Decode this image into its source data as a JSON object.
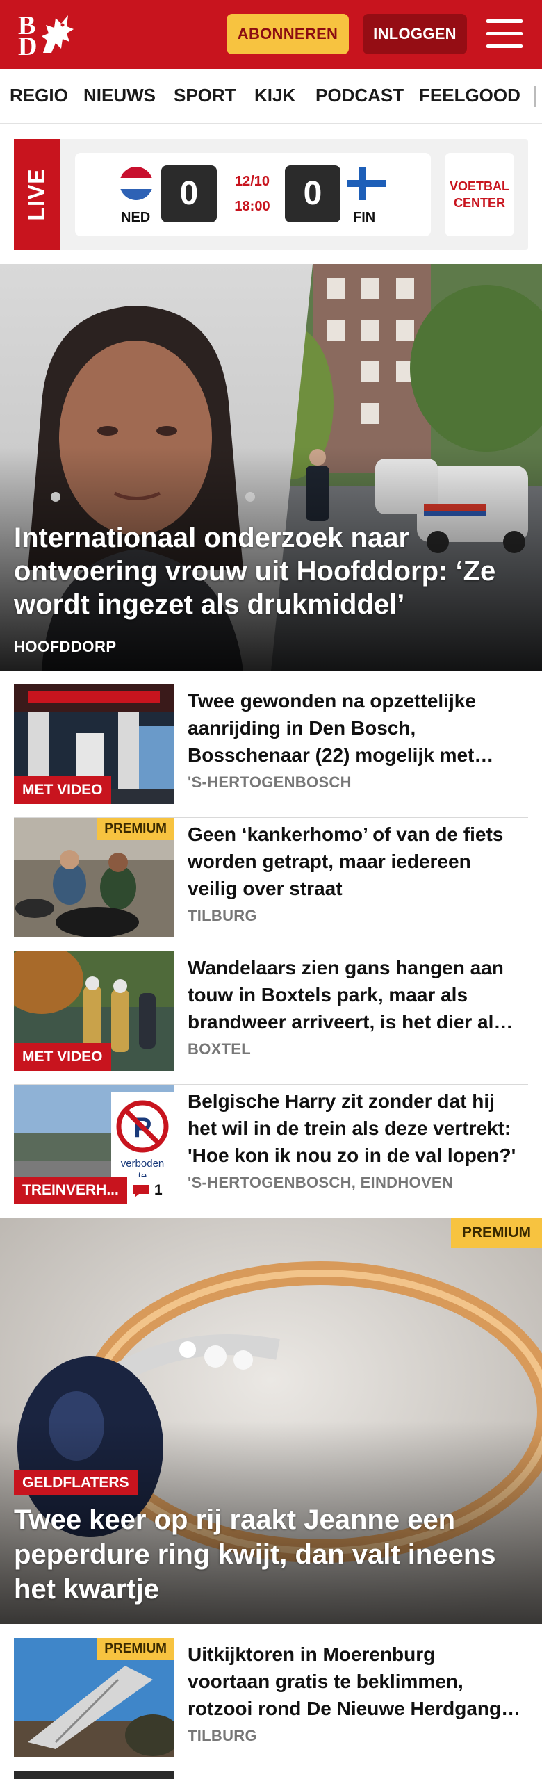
{
  "header": {
    "logo_letters": [
      "B",
      "D"
    ],
    "subscribe_label": "ABONNEREN",
    "login_label": "INLOGGEN"
  },
  "nav": {
    "items": [
      "REGIO",
      "NIEUWS",
      "SPORT",
      "KIJK",
      "PODCAST",
      "FEELGOOD"
    ]
  },
  "live": {
    "tag": "LIVE",
    "home_team": "NED",
    "home_score": "0",
    "date": "12/10",
    "time": "18:00",
    "away_score": "0",
    "away_team": "FIN",
    "voetbal_center": [
      "VOETBAL",
      "CENTER"
    ],
    "colors": {
      "ned": [
        "#c8102e",
        "#ffffff",
        "#2e62b5"
      ],
      "fin_cross": "#1e5fb8"
    }
  },
  "hero": {
    "title": "Internationaal onderzoek naar ontvoering vrouw uit Hoofddorp: ‘Ze wordt ingezet als drukmiddel’",
    "location": "HOOFDDORP"
  },
  "articles": [
    {
      "title": "Twee gewonden na opzettelijke aanrijding in Den Bosch, Bosschenaar (22) mogelijk met psychische problemen",
      "location": "'S-HERTOGENBOSCH",
      "badge": "MET VIDEO",
      "premium": "",
      "comments": ""
    },
    {
      "title": "Geen ‘kankerhomo’ of van de fiets worden getrapt, maar iedereen veilig over straat",
      "location": "TILBURG",
      "badge": "",
      "premium": "PREMIUM",
      "comments": ""
    },
    {
      "title": "Wandelaars zien gans hangen aan touw in Boxtels park, maar als brandweer arriveert, is het dier al weg",
      "location": "BOXTEL",
      "badge": "MET VIDEO",
      "premium": "",
      "comments": ""
    },
    {
      "title": "Belgische Harry zit zonder dat hij het wil in de trein als deze vertrekt: 'Hoe kon ik nou zo in de val lopen?'",
      "location": "'S-HERTOGENBOSCH, EINDHOVEN",
      "badge": "TREINVERH...",
      "premium": "",
      "comments": "1"
    }
  ],
  "big": {
    "premium": "PREMIUM",
    "category": "GELDFLATERS",
    "title": "Twee keer op rij raakt Jeanne een peperdure ring kwijt, dan valt ineens het kwartje"
  },
  "article5": {
    "title": "Uitkijktoren in Moerenburg voortaan gratis te beklimmen, rotzooi rond De Nieuwe Herdgang blijft",
    "location": "TILBURG",
    "premium": "PREMIUM"
  }
}
